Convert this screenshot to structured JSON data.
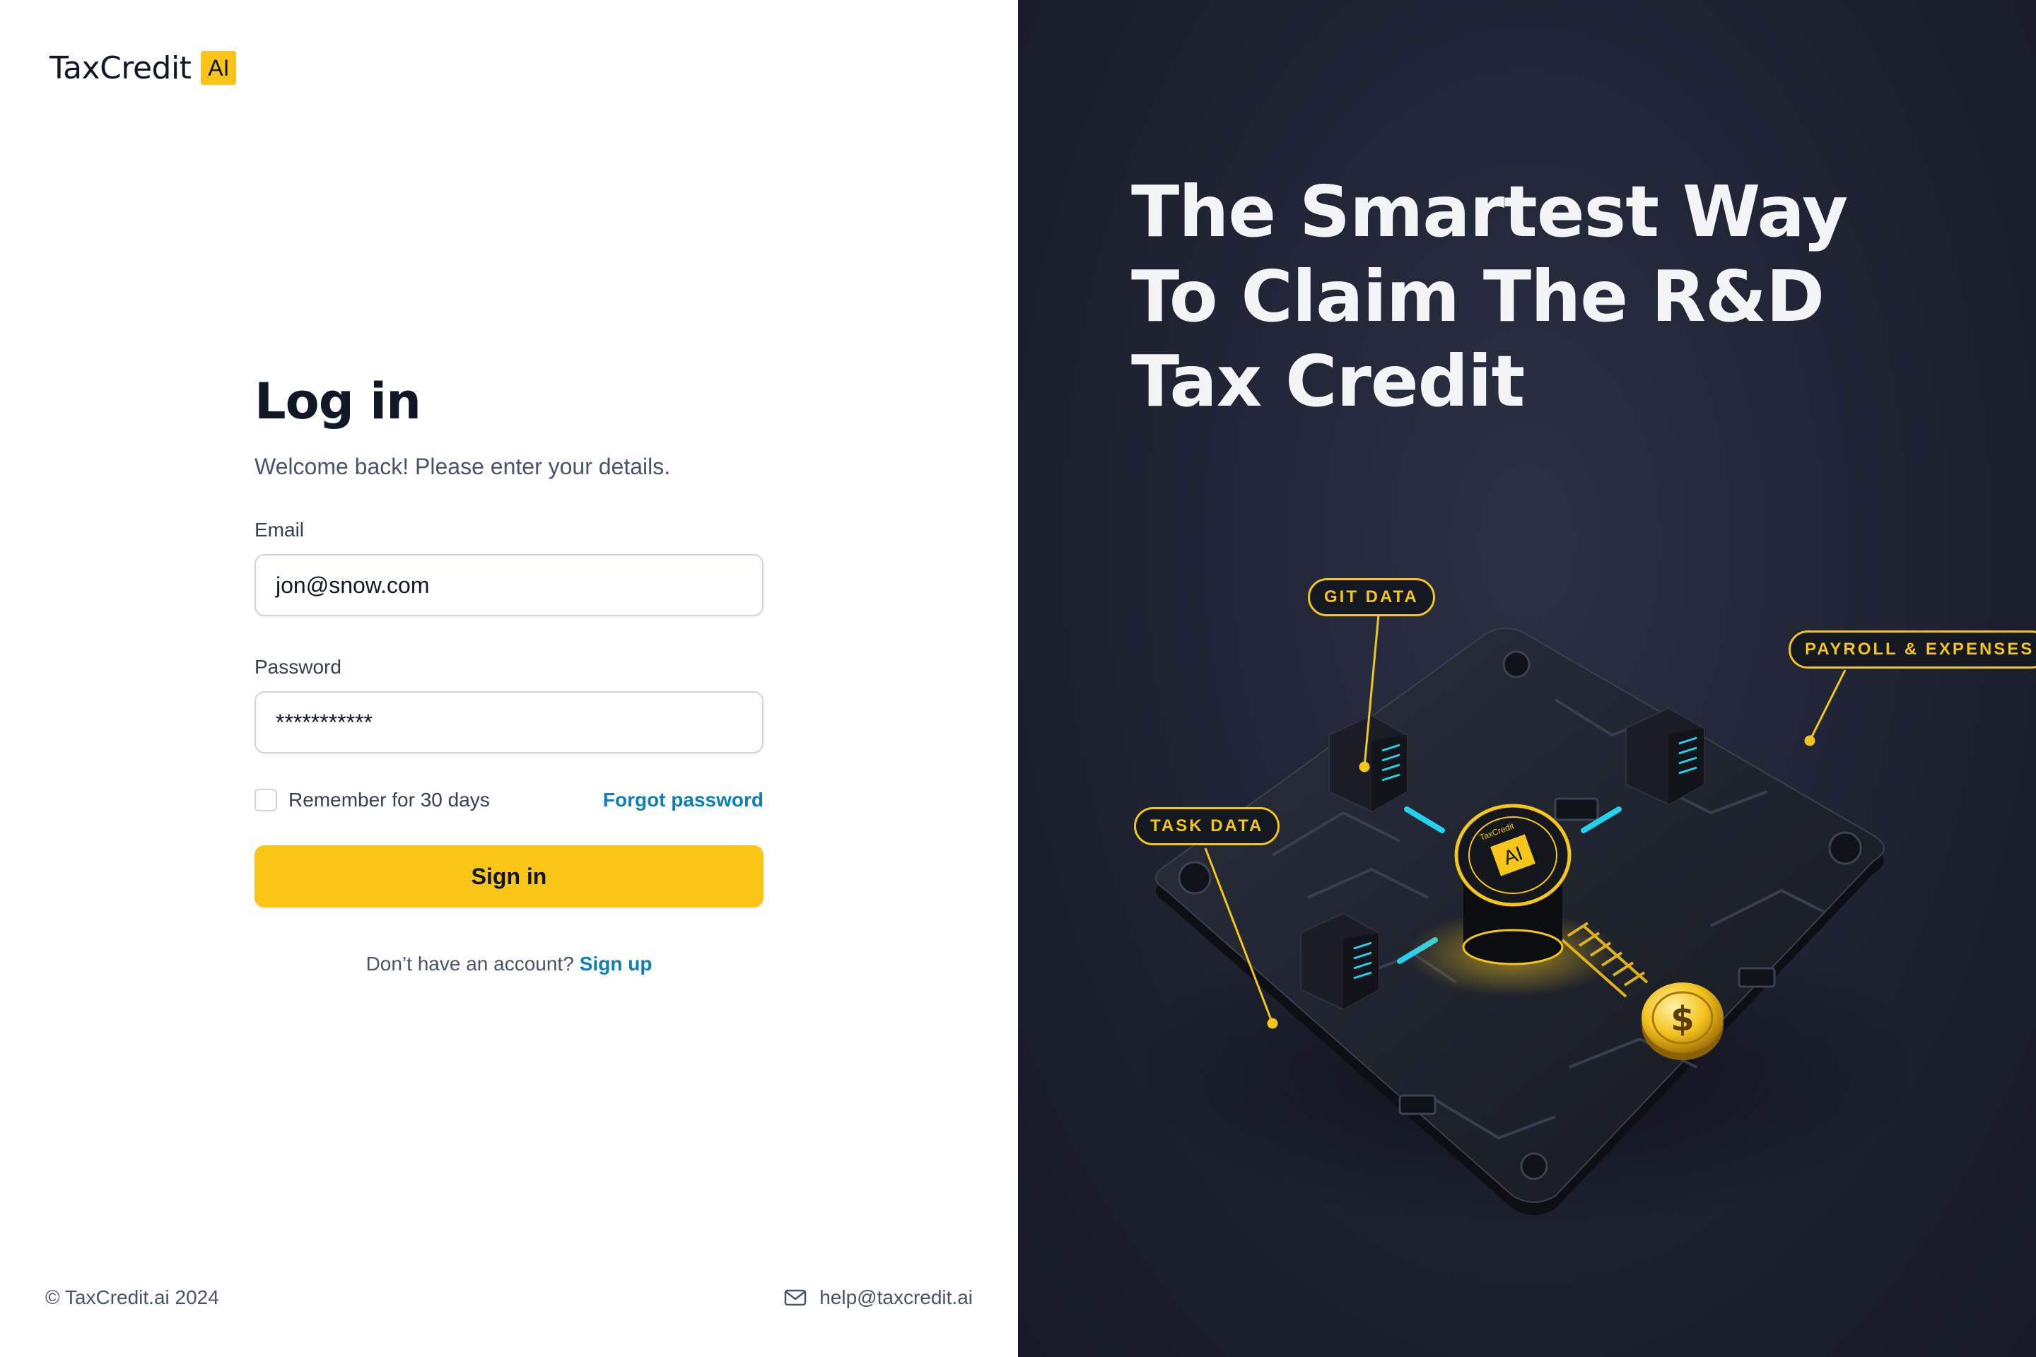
{
  "brand": {
    "name": "TaxCredit",
    "badge": "AI"
  },
  "login": {
    "title": "Log in",
    "subtitle": "Welcome back! Please enter your details.",
    "email_label": "Email",
    "email_value": "jon@snow.com",
    "password_label": "Password",
    "password_value": "***********",
    "remember_label": "Remember for 30 days",
    "forgot_label": "Forgot password",
    "signin_label": "Sign in",
    "signup_prompt": "Don’t have an account?",
    "signup_link": "Sign up"
  },
  "footer": {
    "copyright": "© TaxCredit.ai 2024",
    "email": "help@taxcredit.ai",
    "email_icon": "mail-icon"
  },
  "hero": {
    "headline_lines": [
      "The Smartest Way",
      "To Claim The R&D",
      "Tax Credit"
    ],
    "callouts": {
      "git": "GIT DATA",
      "payroll": "PAYROLL & EXPENSES",
      "task": "TASK DATA"
    },
    "chip_badge": "AI",
    "chip_label": "TaxCredit",
    "coin_symbol": "$"
  },
  "colors": {
    "accent": "#f9c516",
    "link": "#0e7fb5",
    "dark_bg": "#1d2130",
    "glow": "#22d3ee"
  }
}
